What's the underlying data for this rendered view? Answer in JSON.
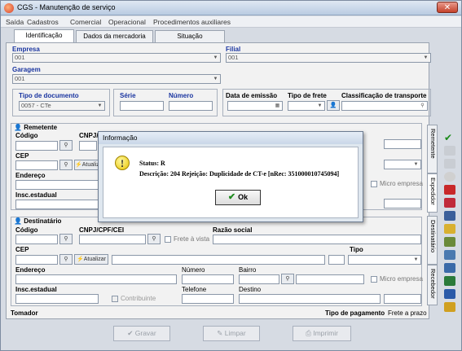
{
  "window": {
    "title": "CGS - Manutenção de serviço",
    "close_label": "✕"
  },
  "menu": [
    "Saída",
    "Cadastros",
    "Comercial",
    "Operacional",
    "Procedimentos auxiliares"
  ],
  "tabs": [
    "Identificação",
    "Dados da mercadoria",
    "Situação"
  ],
  "identificacao": {
    "empresa_label": "Empresa",
    "empresa_value": "001",
    "filial_label": "Filial",
    "filial_value": "001",
    "garagem_label": "Garagem",
    "garagem_value": "001",
    "tipo_doc_label": "Tipo de documento",
    "tipo_doc_value": "0057 - CTe",
    "serie_label": "Série",
    "numero_label": "Número",
    "data_emissao_label": "Data de emissão",
    "tipo_frete_label": "Tipo de frete",
    "classificacao_label": "Classificação de transporte"
  },
  "remetente": {
    "title": "Remetente",
    "codigo_label": "Código",
    "cnpj_label": "CNPJ/",
    "cep_label": "CEP",
    "atualizar_label": "Atualizar",
    "endereco_label": "Endereço",
    "insc_label": "Insc.estadual",
    "micro_label": "Micro empresa"
  },
  "destinatario": {
    "title": "Destinatário",
    "codigo_label": "Código",
    "cnpj_label": "CNPJ/CPF/CEI",
    "frete_label": "Frete à vista",
    "razao_label": "Razão social",
    "cep_label": "CEP",
    "tipo_label": "Tipo",
    "atualizar_label": "Atualizar",
    "endereco_label": "Endereço",
    "numero_label": "Número",
    "bairro_label": "Bairro",
    "micro_label": "Micro empresa",
    "insc_label": "Insc.estadual",
    "contribuinte_label": "Contribuinte",
    "telefone_label": "Telefone",
    "destino_label": "Destino"
  },
  "side_tabs": [
    "Remetente",
    "Expedidor",
    "Destinatário",
    "Recebedor"
  ],
  "footer": {
    "tomador_label": "Tomador",
    "tipo_pagamento_label": "Tipo de pagamento",
    "tipo_pagamento_value": "Frete a prazo"
  },
  "buttons": {
    "gravar": "Gravar",
    "limpar": "Limpar",
    "imprimir": "Imprimir"
  },
  "dialog": {
    "title": "Informação",
    "status": "Status: R",
    "descricao": "Descrição: 204 Rejeição: Duplicidade de CT-e [nRec: 351000010745094]",
    "ok_label": "Ok"
  }
}
